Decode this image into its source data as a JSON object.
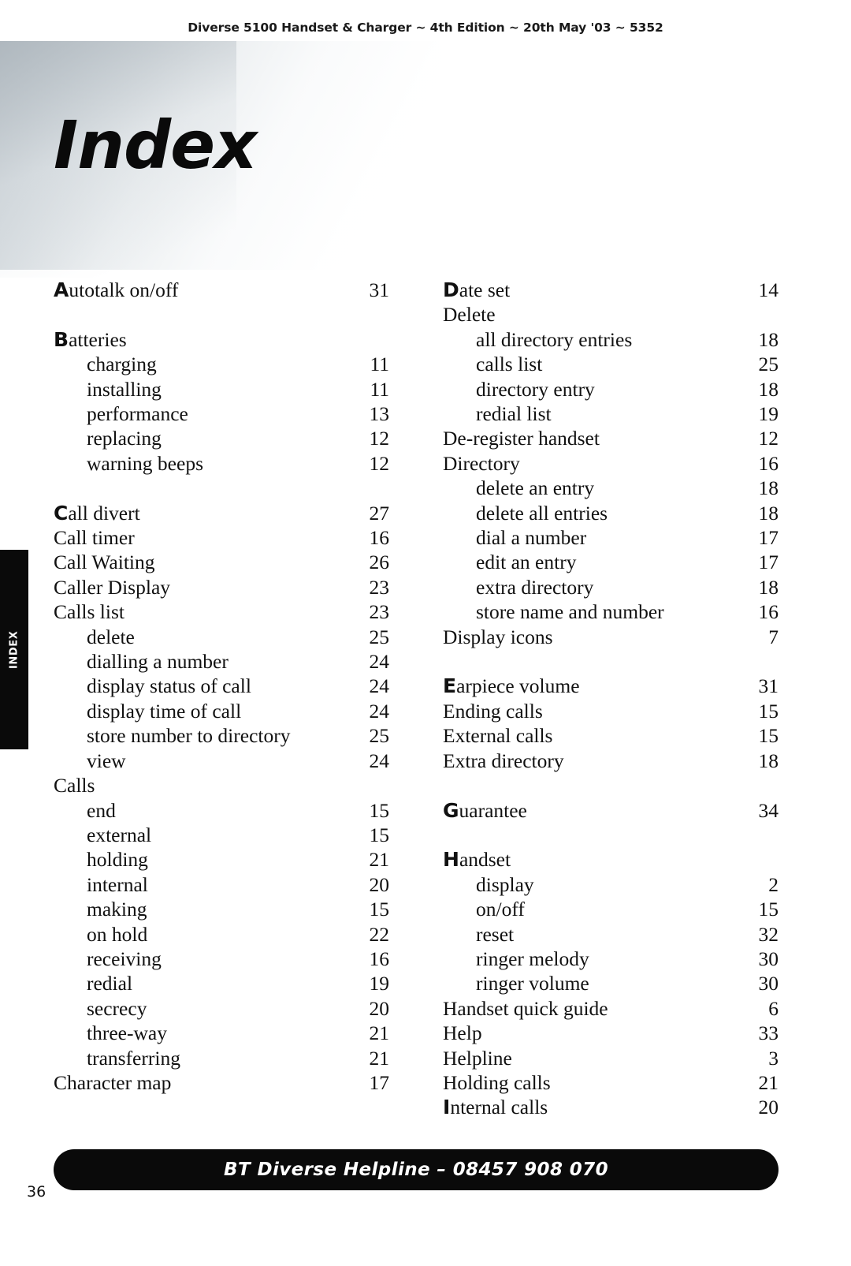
{
  "header": {
    "running_head": "Diverse 5100 Handset & Charger ~ 4th Edition ~ 20th May '03 ~ 5352"
  },
  "title": "Index",
  "side_tab": {
    "label": "INDEX"
  },
  "index": {
    "left_column": [
      {
        "type": "head",
        "initial": "A",
        "rest": "utotalk on/off",
        "page": "31"
      },
      {
        "type": "gap"
      },
      {
        "type": "head",
        "initial": "B",
        "rest": "atteries",
        "page": ""
      },
      {
        "type": "sub",
        "label": "charging",
        "page": "11"
      },
      {
        "type": "sub",
        "label": "installing",
        "page": "11"
      },
      {
        "type": "sub",
        "label": "performance",
        "page": "13"
      },
      {
        "type": "sub",
        "label": "replacing",
        "page": "12"
      },
      {
        "type": "sub",
        "label": "warning beeps",
        "page": "12"
      },
      {
        "type": "gap"
      },
      {
        "type": "head",
        "initial": "C",
        "rest": "all divert",
        "page": "27"
      },
      {
        "type": "item",
        "label": "Call timer",
        "page": "16"
      },
      {
        "type": "item",
        "label": "Call Waiting",
        "page": "26"
      },
      {
        "type": "item",
        "label": "Caller Display",
        "page": "23"
      },
      {
        "type": "item",
        "label": "Calls list",
        "page": "23"
      },
      {
        "type": "sub",
        "label": "delete",
        "page": "25"
      },
      {
        "type": "sub",
        "label": "dialling a number",
        "page": "24"
      },
      {
        "type": "sub",
        "label": "display status of call",
        "page": "24"
      },
      {
        "type": "sub",
        "label": "display time of call",
        "page": "24"
      },
      {
        "type": "sub",
        "label": "store number to directory",
        "page": "25"
      },
      {
        "type": "sub",
        "label": "view",
        "page": "24"
      },
      {
        "type": "item",
        "label": "Calls",
        "page": ""
      },
      {
        "type": "sub",
        "label": "end",
        "page": "15"
      },
      {
        "type": "sub",
        "label": "external",
        "page": "15"
      },
      {
        "type": "sub",
        "label": "holding",
        "page": "21"
      },
      {
        "type": "sub",
        "label": "internal",
        "page": "20"
      },
      {
        "type": "sub",
        "label": "making",
        "page": "15"
      },
      {
        "type": "sub",
        "label": "on hold",
        "page": "22"
      },
      {
        "type": "sub",
        "label": "receiving",
        "page": "16"
      },
      {
        "type": "sub",
        "label": "redial",
        "page": "19"
      },
      {
        "type": "sub",
        "label": "secrecy",
        "page": "20"
      },
      {
        "type": "sub",
        "label": "three-way",
        "page": "21"
      },
      {
        "type": "sub",
        "label": "transferring",
        "page": "21"
      },
      {
        "type": "item",
        "label": "Character map",
        "page": "17"
      }
    ],
    "right_column": [
      {
        "type": "head",
        "initial": "D",
        "rest": "ate set",
        "page": "14"
      },
      {
        "type": "item",
        "label": "Delete",
        "page": ""
      },
      {
        "type": "sub",
        "label": "all directory entries",
        "page": "18"
      },
      {
        "type": "sub",
        "label": "calls list",
        "page": "25"
      },
      {
        "type": "sub",
        "label": "directory entry",
        "page": "18"
      },
      {
        "type": "sub",
        "label": "redial list",
        "page": "19"
      },
      {
        "type": "item",
        "label": "De-register handset",
        "page": "12"
      },
      {
        "type": "item",
        "label": "Directory",
        "page": "16"
      },
      {
        "type": "sub",
        "label": "delete an entry",
        "page": "18"
      },
      {
        "type": "sub",
        "label": "delete all entries",
        "page": "18"
      },
      {
        "type": "sub",
        "label": "dial a number",
        "page": "17"
      },
      {
        "type": "sub",
        "label": "edit an entry",
        "page": "17"
      },
      {
        "type": "sub",
        "label": "extra directory",
        "page": "18"
      },
      {
        "type": "sub",
        "label": "store name and number",
        "page": "16"
      },
      {
        "type": "item",
        "label": "Display icons",
        "page": "7"
      },
      {
        "type": "gap"
      },
      {
        "type": "head",
        "initial": "E",
        "rest": "arpiece volume",
        "page": "31"
      },
      {
        "type": "item",
        "label": "Ending calls",
        "page": "15"
      },
      {
        "type": "item",
        "label": "External calls",
        "page": "15"
      },
      {
        "type": "item",
        "label": "Extra directory",
        "page": "18"
      },
      {
        "type": "gap"
      },
      {
        "type": "head",
        "initial": "G",
        "rest": "uarantee",
        "page": "34"
      },
      {
        "type": "gap"
      },
      {
        "type": "head",
        "initial": "H",
        "rest": "andset",
        "page": ""
      },
      {
        "type": "sub",
        "label": "display",
        "page": "2"
      },
      {
        "type": "sub",
        "label": "on/off",
        "page": "15"
      },
      {
        "type": "sub",
        "label": "reset",
        "page": "32"
      },
      {
        "type": "sub",
        "label": "ringer melody",
        "page": "30"
      },
      {
        "type": "sub",
        "label": "ringer volume",
        "page": "30"
      },
      {
        "type": "item",
        "label": "Handset quick guide",
        "page": "6"
      },
      {
        "type": "item",
        "label": "Help",
        "page": "33"
      },
      {
        "type": "item",
        "label": "Helpline",
        "page": "3"
      },
      {
        "type": "item",
        "label": "Holding calls",
        "page": "21"
      },
      {
        "type": "head",
        "initial": "I",
        "rest": "nternal calls",
        "page": "20"
      }
    ]
  },
  "footer": {
    "helpline_banner": "BT Diverse Helpline – 08457 908 070",
    "page_number": "36"
  }
}
